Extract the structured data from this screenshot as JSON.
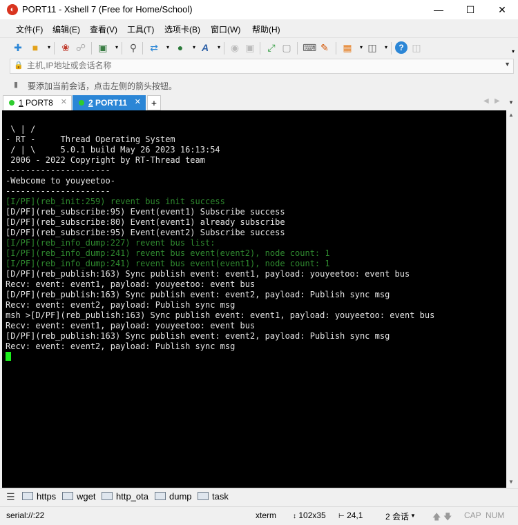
{
  "window": {
    "title": "PORT11 - Xshell 7 (Free for Home/School)"
  },
  "menu": [
    {
      "label": "文件(F)"
    },
    {
      "label": "编辑(E)"
    },
    {
      "label": "查看(V)"
    },
    {
      "label": "工具(T)"
    },
    {
      "label": "选项卡(B)"
    },
    {
      "label": "窗口(W)"
    },
    {
      "label": "帮助(H)"
    }
  ],
  "address": {
    "placeholder": "主机,IP地址或会话名称"
  },
  "info": {
    "text": "要添加当前会话，点击左侧的箭头按钮。"
  },
  "tabs": [
    {
      "index": "1",
      "name": "PORT8",
      "active": false
    },
    {
      "index": "2",
      "name": "PORT11",
      "active": true
    }
  ],
  "terminal": {
    "lines": [
      {
        "text": " \\ | /",
        "color": "white"
      },
      {
        "text": "- RT -     Thread Operating System",
        "color": "white"
      },
      {
        "text": " / | \\     5.0.1 build May 26 2023 16:13:54",
        "color": "white"
      },
      {
        "text": " 2006 - 2022 Copyright by RT-Thread team",
        "color": "white"
      },
      {
        "text": "---------------------",
        "color": "white"
      },
      {
        "text": "-Webcome to youyeetoo-",
        "color": "white"
      },
      {
        "text": "---------------------",
        "color": "white"
      },
      {
        "text": "[I/PF](reb_init:259) revent bus init success",
        "color": "green"
      },
      {
        "text": "[D/PF](reb_subscribe:95) Event(event1) Subscribe success",
        "color": "white"
      },
      {
        "text": "[D/PF](reb_subscribe:80) Event(event1) already subscribe",
        "color": "white"
      },
      {
        "text": "[D/PF](reb_subscribe:95) Event(event2) Subscribe success",
        "color": "white"
      },
      {
        "text": "[I/PF](reb_info_dump:227) revent bus list:",
        "color": "green"
      },
      {
        "text": "[I/PF](reb_info_dump:241) revent bus event(event2), node count: 1",
        "color": "green"
      },
      {
        "text": "[I/PF](reb_info_dump:241) revent bus event(event1), node count: 1",
        "color": "green"
      },
      {
        "text": "[D/PF](reb_publish:163) Sync publish event: event1, payload: youyeetoo: event bus",
        "color": "white"
      },
      {
        "text": "Recv: event: event1, payload: youyeetoo: event bus",
        "color": "white"
      },
      {
        "text": "[D/PF](reb_publish:163) Sync publish event: event2, payload: Publish sync msg",
        "color": "white"
      },
      {
        "text": "Recv: event: event2, payload: Publish sync msg",
        "color": "white"
      },
      {
        "text": "msh >[D/PF](reb_publish:163) Sync publish event: event1, payload: youyeetoo: event bus",
        "color": "white"
      },
      {
        "text": "Recv: event: event1, payload: youyeetoo: event bus",
        "color": "white"
      },
      {
        "text": "[D/PF](reb_publish:163) Sync publish event: event2, payload: Publish sync msg",
        "color": "white"
      },
      {
        "text": "Recv: event: event2, payload: Publish sync msg",
        "color": "white"
      }
    ],
    "colors": {
      "background": "#000000",
      "text": "#e6e6e6",
      "info_green": "#2f8a2f",
      "cursor": "#1bef1b"
    }
  },
  "quickbar": [
    {
      "label": "https"
    },
    {
      "label": "wget"
    },
    {
      "label": "http_ota"
    },
    {
      "label": "dump"
    },
    {
      "label": "task"
    }
  ],
  "status": {
    "connection": "serial://:22",
    "term_type": "xterm",
    "size": "102x35",
    "cursor_pos": "24,1",
    "sessions": "2 会话",
    "cap": "CAP",
    "num": "NUM"
  },
  "colors": {
    "accent": "#2b86d6",
    "tab_dot": "#2ecc2e"
  }
}
